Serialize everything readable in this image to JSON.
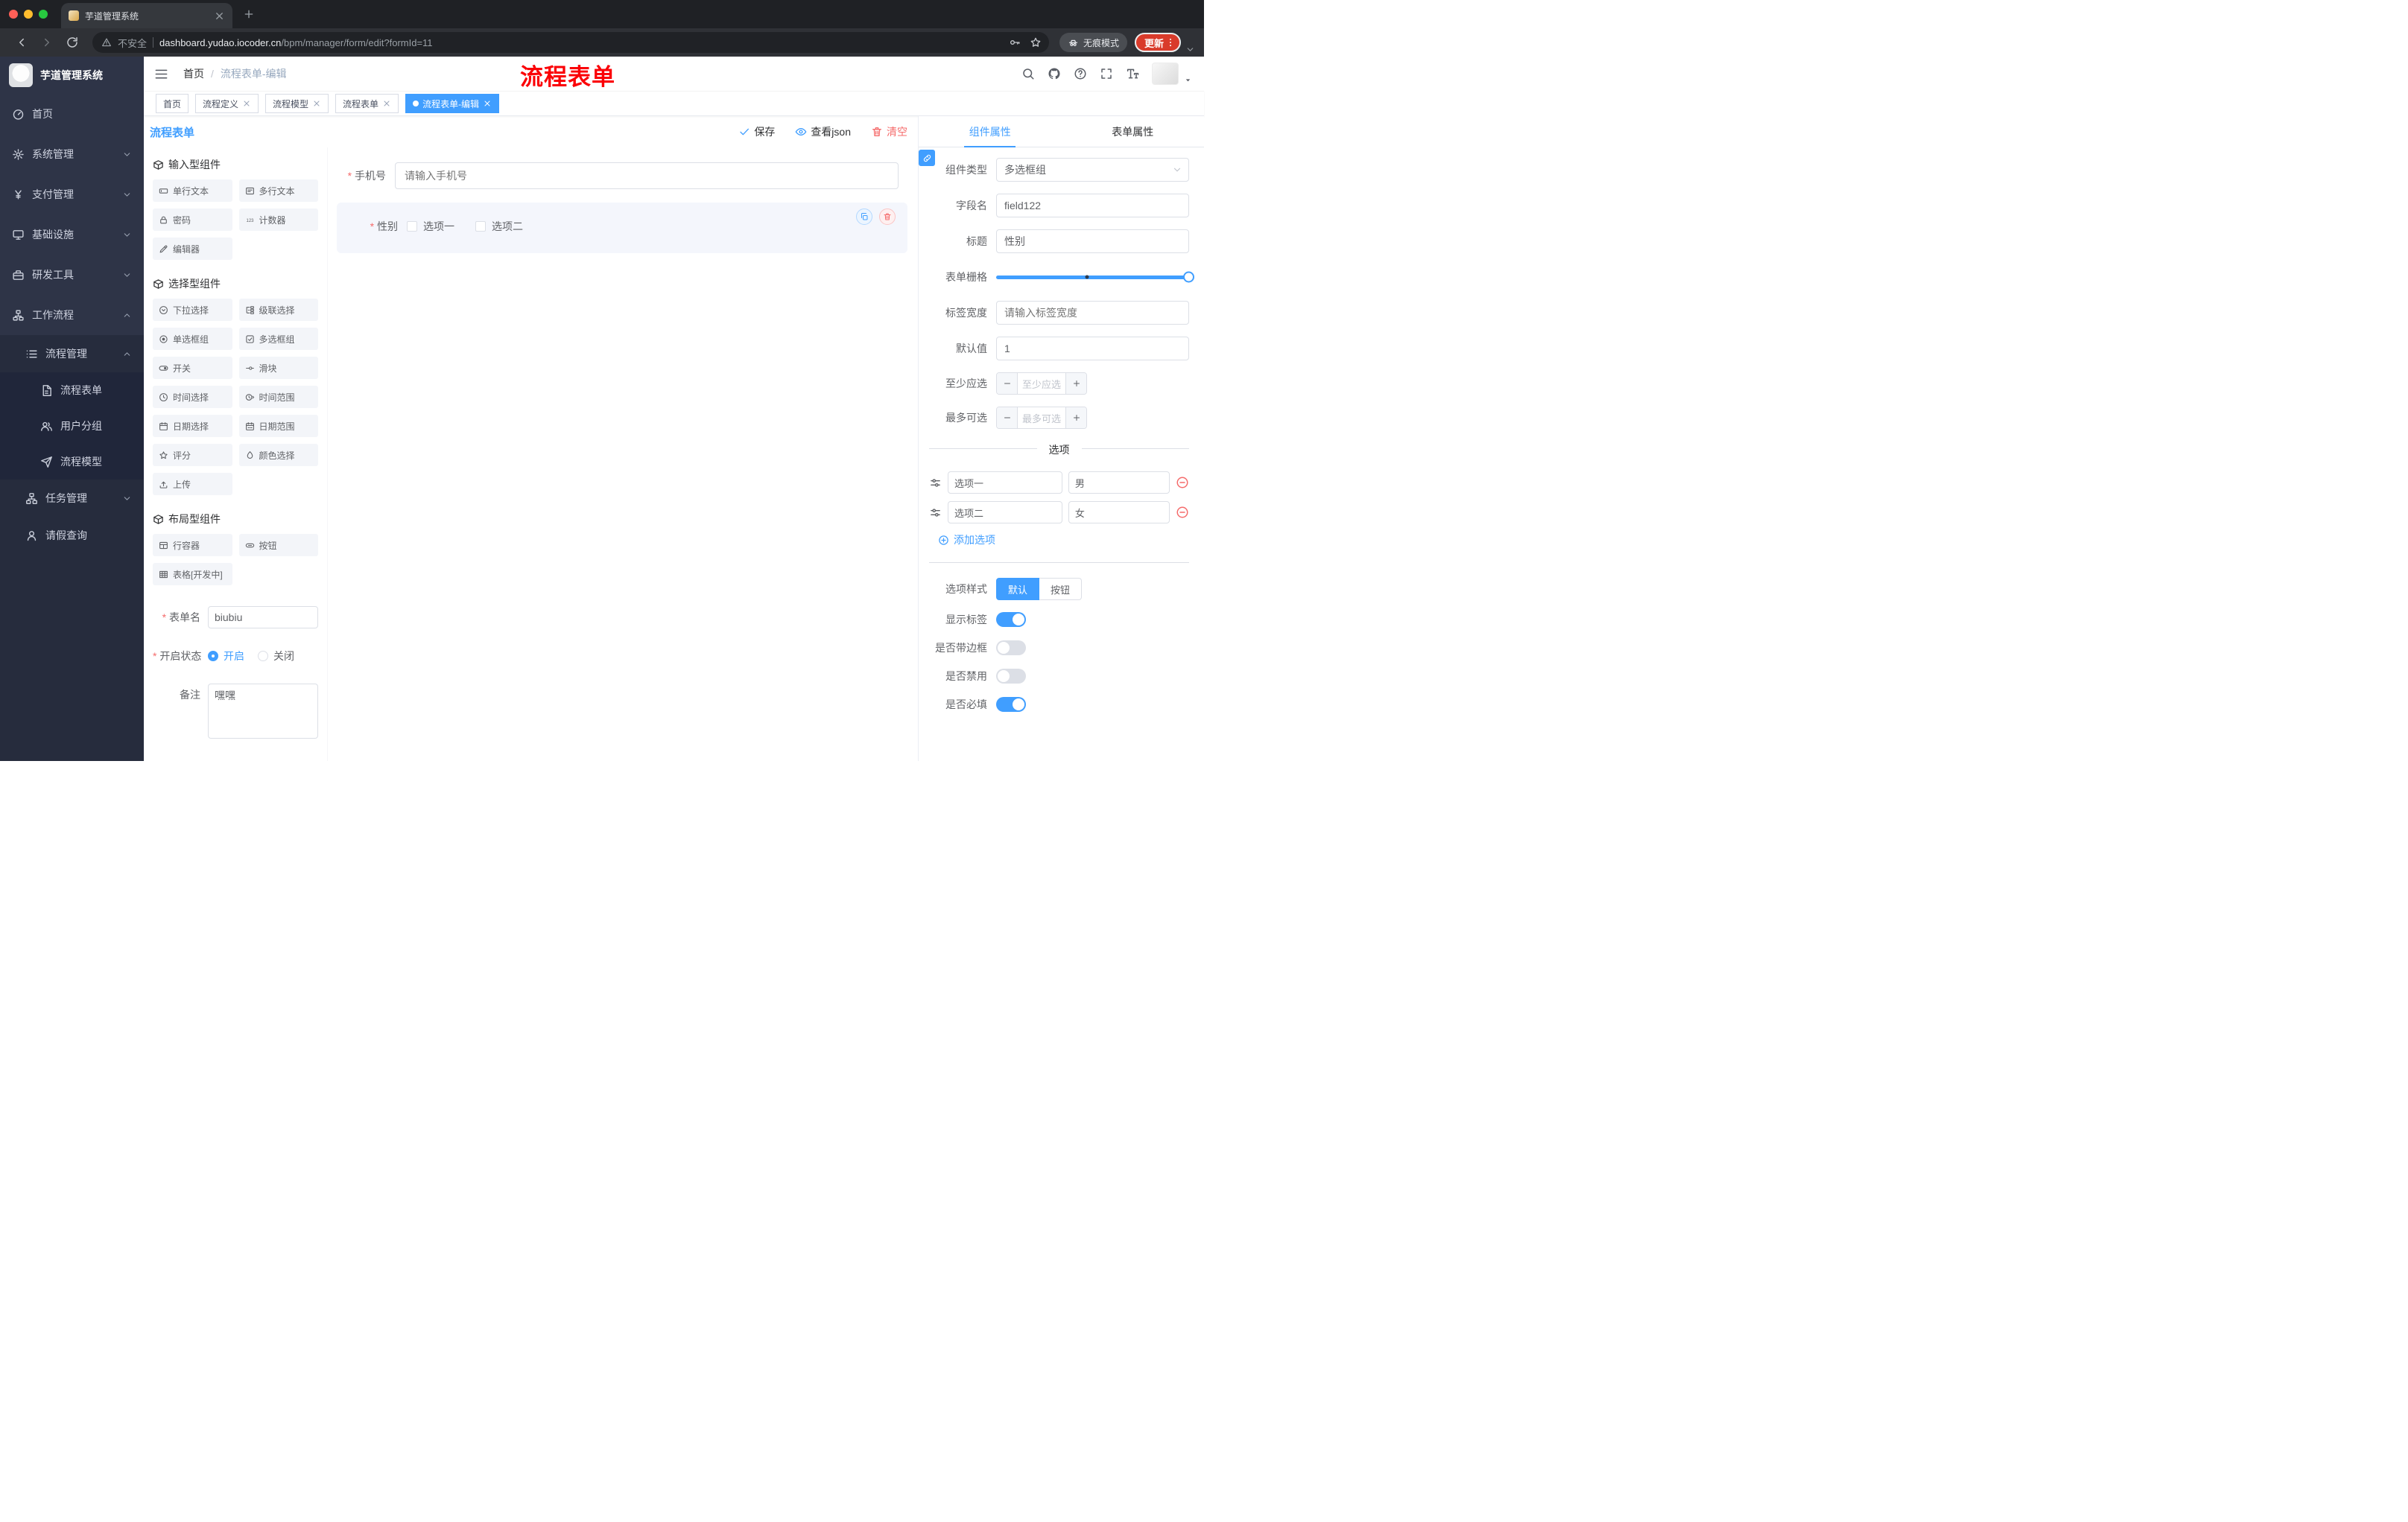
{
  "colors": {
    "accent": "#409eff",
    "danger": "#f56c6c",
    "sidebar_bg": "#2e3447",
    "annotation_red": "#fb0006",
    "update_button_red": "#d93b2b",
    "active_tag_blue": "#409eff"
  },
  "browser": {
    "tab_title": "芋道管理系统",
    "security_label": "不安全",
    "url_domain": "dashboard.yudao.iocoder.cn",
    "url_path": "/bpm/manager/form/edit?formId=11",
    "incognito_label": "无痕模式",
    "update_label": "更新"
  },
  "sidebar": {
    "logo_title": "芋道管理系统",
    "items": [
      {
        "label": "首页",
        "icon": "dashboard-icon"
      },
      {
        "label": "系统管理",
        "icon": "gear-icon"
      },
      {
        "label": "支付管理",
        "icon": "yen-icon"
      },
      {
        "label": "基础设施",
        "icon": "monitor-icon"
      },
      {
        "label": "研发工具",
        "icon": "toolbox-icon"
      },
      {
        "label": "工作流程",
        "icon": "workflow-icon"
      },
      {
        "label": "流程管理",
        "icon": "list-icon"
      },
      {
        "label": "流程表单",
        "icon": "document-icon"
      },
      {
        "label": "用户分组",
        "icon": "users-icon"
      },
      {
        "label": "流程模型",
        "icon": "send-icon"
      },
      {
        "label": "任务管理",
        "icon": "tree-icon"
      },
      {
        "label": "请假查询",
        "icon": "user-icon"
      }
    ]
  },
  "header": {
    "breadcrumb_home": "首页",
    "breadcrumb_sep": "/",
    "breadcrumb_current": "流程表单-编辑",
    "annotation": "流程表单"
  },
  "tags": [
    {
      "label": "首页"
    },
    {
      "label": "流程定义"
    },
    {
      "label": "流程模型"
    },
    {
      "label": "流程表单"
    },
    {
      "label": "流程表单-编辑"
    }
  ],
  "designer": {
    "title": "流程表单",
    "actions": {
      "save": "保存",
      "view_json": "查看json",
      "clear": "清空"
    },
    "groups": [
      {
        "title": "输入型组件",
        "items": [
          {
            "label": "单行文本",
            "icon": "input-icon"
          },
          {
            "label": "多行文本",
            "icon": "textarea-icon"
          },
          {
            "label": "密码",
            "icon": "lock-icon"
          },
          {
            "label": "计数器",
            "icon": "counter-icon"
          },
          {
            "label": "编辑器",
            "icon": "editor-icon"
          }
        ]
      },
      {
        "title": "选择型组件",
        "items": [
          {
            "label": "下拉选择",
            "icon": "select-icon"
          },
          {
            "label": "级联选择",
            "icon": "cascader-icon"
          },
          {
            "label": "单选框组",
            "icon": "radio-icon"
          },
          {
            "label": "多选框组",
            "icon": "checkbox-icon"
          },
          {
            "label": "开关",
            "icon": "switch-icon"
          },
          {
            "label": "滑块",
            "icon": "slider-icon"
          },
          {
            "label": "时间选择",
            "icon": "time-icon"
          },
          {
            "label": "时间范围",
            "icon": "time-range-icon"
          },
          {
            "label": "日期选择",
            "icon": "date-icon"
          },
          {
            "label": "日期范围",
            "icon": "date-range-icon"
          },
          {
            "label": "评分",
            "icon": "rate-icon"
          },
          {
            "label": "颜色选择",
            "icon": "color-icon"
          },
          {
            "label": "上传",
            "icon": "upload-icon"
          }
        ]
      },
      {
        "title": "布局型组件",
        "items": [
          {
            "label": "行容器",
            "icon": "row-icon"
          },
          {
            "label": "按钮",
            "icon": "button-icon"
          },
          {
            "label": "表格[开发中]",
            "icon": "table-icon"
          }
        ]
      }
    ],
    "meta": {
      "name_label": "表单名",
      "name_value": "biubiu",
      "status_label": "开启状态",
      "status_on": "开启",
      "status_off": "关闭",
      "remark_label": "备注",
      "remark_value": "嘿嘿"
    }
  },
  "canvas": {
    "phone_label": "手机号",
    "phone_placeholder": "请输入手机号",
    "gender_label": "性别",
    "gender_options": [
      "选项一",
      "选项二"
    ]
  },
  "props": {
    "tabs": [
      "组件属性",
      "表单属性"
    ],
    "type_label": "组件类型",
    "type_value": "多选框组",
    "field_label": "字段名",
    "field_value": "field122",
    "title_label": "标题",
    "title_value": "性别",
    "grid_label": "表单栅格",
    "label_width_label": "标签宽度",
    "label_width_placeholder": "请输入标签宽度",
    "default_label": "默认值",
    "default_value": "1",
    "min_label": "至少应选",
    "min_placeholder": "至少应选",
    "max_label": "最多可选",
    "max_placeholder": "最多可选",
    "options_divider": "选项",
    "options": [
      {
        "label": "选项一",
        "value": "男"
      },
      {
        "label": "选项二",
        "value": "女"
      }
    ],
    "add_option": "添加选项",
    "style_label": "选项样式",
    "style_options": [
      "默认",
      "按钮"
    ],
    "show_label_label": "显示标签",
    "border_label": "是否带边框",
    "disabled_label": "是否禁用",
    "required_label": "是否必填"
  }
}
